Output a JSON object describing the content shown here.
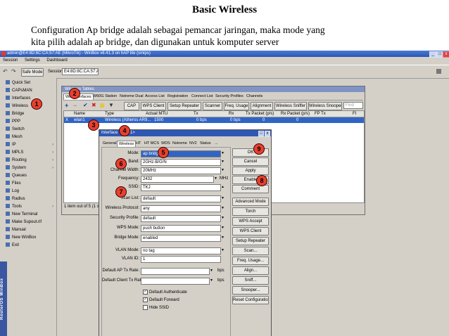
{
  "slide": {
    "title": "Basic Wireless",
    "line1": "Configuration Ap bridge adalah sebagai pemancar jaringan, maka mode yang",
    "line2": "kita pilih adalah ap bridge, dan digunakan untuk komputer server"
  },
  "window": {
    "title": "admin@E4:8D:8C:CA:57:AE (MikroTik) - WinBox v6.41.3 on hAP lite (smips)",
    "menu": [
      "Session",
      "Settings",
      "Dashboard"
    ],
    "safe_mode": "Safe Mode",
    "session_label": "Session:",
    "session_value": "E4:8D:8C:CA:57:AE",
    "side_logo": "RouterOS WinBox"
  },
  "sidebar": {
    "items": [
      "Quick Set",
      "CAPsMAN",
      "Interfaces",
      "Wireless",
      "Bridge",
      "PPP",
      "Switch",
      "Mesh",
      "IP",
      "MPLS",
      "Routing",
      "System",
      "Queues",
      "Files",
      "Log",
      "Radius",
      "Tools",
      "New Terminal",
      "Make Supout.rif",
      "Manual",
      "New WinBox",
      "Exit"
    ]
  },
  "wireless_window": {
    "title": "Wireless Tables",
    "tabs": [
      "WiFi Interfaces",
      "W60G Station",
      "Nstreme Dual",
      "Access List",
      "Registration",
      "Connect List",
      "Security Profiles",
      "Channels"
    ],
    "toolbar": [
      "CAP",
      "WPS Client",
      "Setup Repeater",
      "Scanner",
      "Freq. Usage",
      "Alignment",
      "Wireless Sniffer",
      "Wireless Snooper"
    ],
    "find_placeholder": "Find",
    "columns": [
      "Name",
      "Type",
      "Actual MTU",
      "Tx",
      "Rx",
      "Tx Packet (p/s)",
      "Rx Packet (p/s)",
      "FP Tx",
      "FI"
    ],
    "row": {
      "flag": "X",
      "name": "wlan1",
      "type": "Wireless (Atheros AR9...",
      "mtu": "1500",
      "tx": "0 bps",
      "rx": "0 bps",
      "txp": "0",
      "rxp": "0"
    },
    "status": "1 item out of 5 (1 selected)"
  },
  "dialog": {
    "title": "Interface <wlan1>",
    "tabs": [
      "General",
      "Wireless",
      "HT",
      "HT MCS",
      "WDS",
      "Nstreme",
      "NV2",
      "Status",
      "..."
    ],
    "fields": {
      "mode": {
        "label": "Mode:",
        "value": "ap bridge"
      },
      "band": {
        "label": "Band:",
        "value": "2GHz-B/G/N"
      },
      "channel_width": {
        "label": "Channel Width:",
        "value": "20MHz"
      },
      "frequency": {
        "label": "Frequency:",
        "value": "2432",
        "unit": "MHz"
      },
      "ssid": {
        "label": "SSID:",
        "value": "TKJ"
      },
      "scan_list": {
        "label": "Scan List:",
        "value": "default"
      },
      "wireless_protocol": {
        "label": "Wireless Protocol:",
        "value": "any"
      },
      "security_profile": {
        "label": "Security Profile:",
        "value": "default"
      },
      "wps_mode": {
        "label": "WPS Mode:",
        "value": "push button"
      },
      "bridge_mode": {
        "label": "Bridge Mode:",
        "value": "enabled"
      },
      "vlan_mode": {
        "label": "VLAN Mode:",
        "value": "no tag"
      },
      "vlan_id": {
        "label": "VLAN ID:",
        "value": "1"
      },
      "default_ap_tx": {
        "label": "Default AP Tx Rate:",
        "value": "",
        "unit": "bps"
      },
      "default_client_tx": {
        "label": "Default Client Tx Rate:",
        "value": "",
        "unit": "bps"
      }
    },
    "checkboxes": [
      {
        "label": "Default Authenticate",
        "checked": true
      },
      {
        "label": "Default Forward",
        "checked": true
      },
      {
        "label": "Hide SSID",
        "checked": false
      }
    ],
    "buttons": [
      "OK",
      "Cancel",
      "Apply",
      "Enable",
      "Comment",
      "Advanced Mode",
      "Torch",
      "WPS Accept",
      "WPS Client",
      "Setup Repeater",
      "Scan...",
      "Freq. Usage...",
      "Align...",
      "Sniff...",
      "Snooper...",
      "Reset Configuration"
    ]
  },
  "markers": [
    "1",
    "2",
    "3",
    "4",
    "5",
    "6",
    "7",
    "8",
    "9"
  ],
  "colors": {
    "marker": "#e8402e",
    "titlebar": "#2f57b4",
    "selected_row": "#3165c4"
  }
}
